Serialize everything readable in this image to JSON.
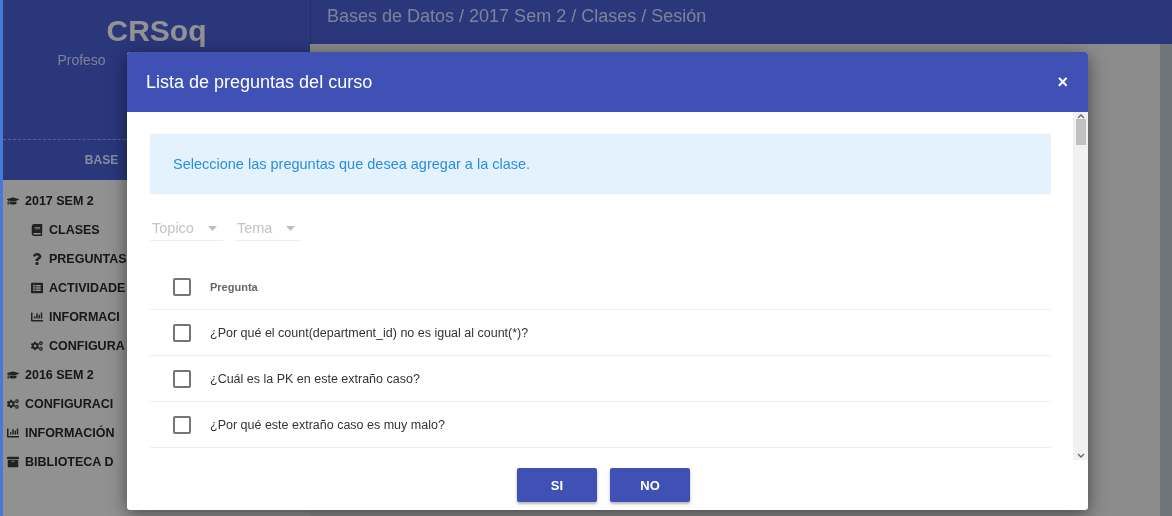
{
  "sidebar": {
    "brand": "CRSoq",
    "role": "Profeso",
    "course": "BASE",
    "items": [
      {
        "label": "2017 SEM 2",
        "children": [
          {
            "label": "CLASES"
          },
          {
            "label": "PREGUNTAS"
          },
          {
            "label": "ACTIVIDADE"
          },
          {
            "label": "INFORMACI"
          },
          {
            "label": "CONFIGURA"
          }
        ]
      },
      {
        "label": "2016 SEM 2"
      },
      {
        "label": "CONFIGURACI"
      },
      {
        "label": "INFORMACIÓN"
      },
      {
        "label": "BIBLIOTECA D"
      }
    ]
  },
  "breadcrumb": "Bases de Datos / 2017 Sem 2 / Clases / Sesión",
  "dialog": {
    "title": "Lista de preguntas del curso",
    "close": "×",
    "notice": "Seleccione las preguntas que desea agregar a la clase.",
    "filters": [
      {
        "placeholder": "Topico"
      },
      {
        "placeholder": "Tema"
      }
    ],
    "table": {
      "header": {
        "label": "Pregunta",
        "checked": false
      },
      "rows": [
        {
          "text": "¿Por qué el count(department_id) no es igual al count(*)?",
          "checked": false
        },
        {
          "text": "¿Cuál es la PK en este extraño caso?",
          "checked": false
        },
        {
          "text": "¿Por qué este extraño caso es muy malo?",
          "checked": false
        }
      ]
    },
    "buttons": [
      "SI",
      "NO"
    ]
  }
}
